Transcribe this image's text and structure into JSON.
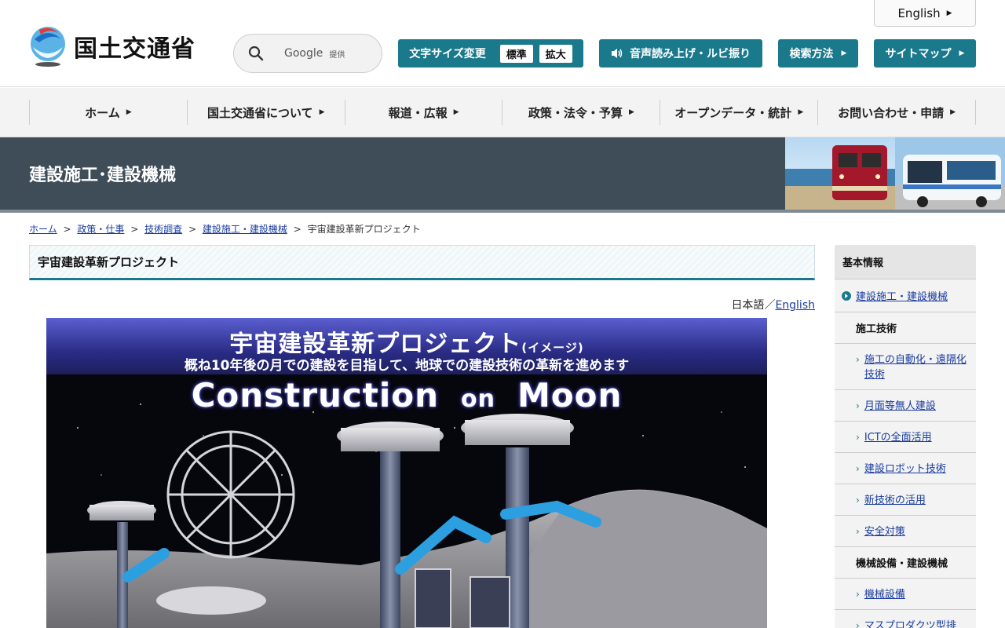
{
  "header": {
    "logo_text": "国土交通省",
    "lang_tab": "English",
    "search": {
      "brand": "Google",
      "provided": "提供"
    },
    "buttons": {
      "font_size": "文字サイズ変更",
      "size_normal": "標準",
      "size_large": "拡大",
      "read_aloud": "音声読み上げ・ルビ振り",
      "search_method": "検索方法",
      "sitemap": "サイトマップ"
    }
  },
  "gnav": {
    "items": [
      {
        "label": "ホーム"
      },
      {
        "label": "国土交通省について"
      },
      {
        "label": "報道・広報"
      },
      {
        "label": "政策・法令・予算"
      },
      {
        "label": "オープンデータ・統計"
      },
      {
        "label": "お問い合わせ・申請"
      }
    ]
  },
  "banner": {
    "title": "建設施工･建設機械"
  },
  "breadcrumb": {
    "items": [
      {
        "label": "ホーム"
      },
      {
        "label": "政策・仕事"
      },
      {
        "label": "技術調査"
      },
      {
        "label": "建設施工・建設機械"
      }
    ],
    "current": "宇宙建設革新プロジェクト",
    "sep": ">"
  },
  "main": {
    "title": "宇宙建設革新プロジェクト",
    "lang_switch": {
      "ja": "日本語",
      "slash": "／",
      "en": "English"
    },
    "hero": {
      "title": "宇宙建設革新プロジェクト",
      "title_note": "(イメージ)",
      "subtitle": "概ね10年後の月での建設を目指して、地球での建設技術の革新を進めます",
      "en_left": "Construction",
      "en_mid": "on",
      "en_right": "Moon"
    }
  },
  "sidebar": {
    "heading": "基本情報",
    "current": "建設施工・建設機械",
    "groups": [
      {
        "label": "施工技術",
        "links": [
          "施工の自動化・遠隔化技術",
          "月面等無人建設",
          "ICTの全面活用",
          "建設ロボット技術",
          "新技術の活用",
          "安全対策"
        ]
      },
      {
        "label": "機械設備・建設機械",
        "links": [
          "機械設備",
          "マスプロダクツ型排"
        ]
      }
    ]
  },
  "colors": {
    "accent": "#1a7a8c",
    "banner": "#3e4d58",
    "link": "#1a3c9e"
  }
}
